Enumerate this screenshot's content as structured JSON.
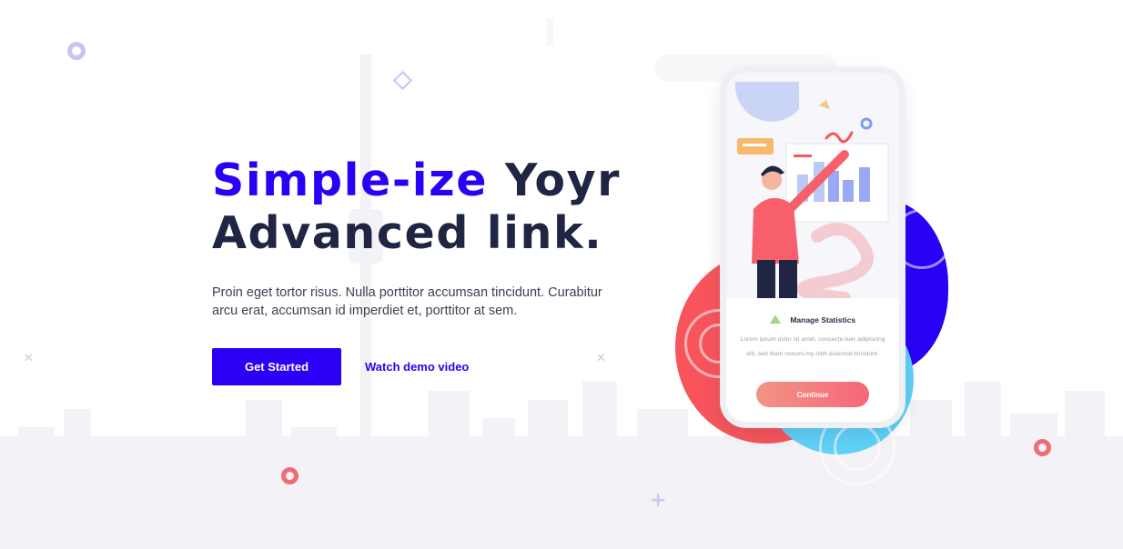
{
  "hero": {
    "headline_accent": "Simple-ize",
    "headline_rest_line1": "Yoyr",
    "headline_line2": "Advanced link.",
    "lead": "Proin eget tortor risus. Nulla porttitor accumsan tincidunt. Curabitur arcu erat, accumsan id imperdiet et, porttitor at sem.",
    "primary_cta": "Get Started",
    "secondary_cta": "Watch demo video"
  },
  "phone_card": {
    "title": "Manage Statistics",
    "body": "Lorem ipsum dolor sit amet, consecte-tuer adipiscing elit, sed diam nonum-my nibh euismod tincidunt.",
    "button": "Continue"
  },
  "colors": {
    "accent": "#2b00f4",
    "heading": "#1f2542",
    "coral": "#f7555b",
    "cyan": "#5fd0f6"
  },
  "icons": {
    "decorations": [
      "ring-icon",
      "diamond-icon",
      "cross-icon",
      "plus-icon"
    ]
  }
}
